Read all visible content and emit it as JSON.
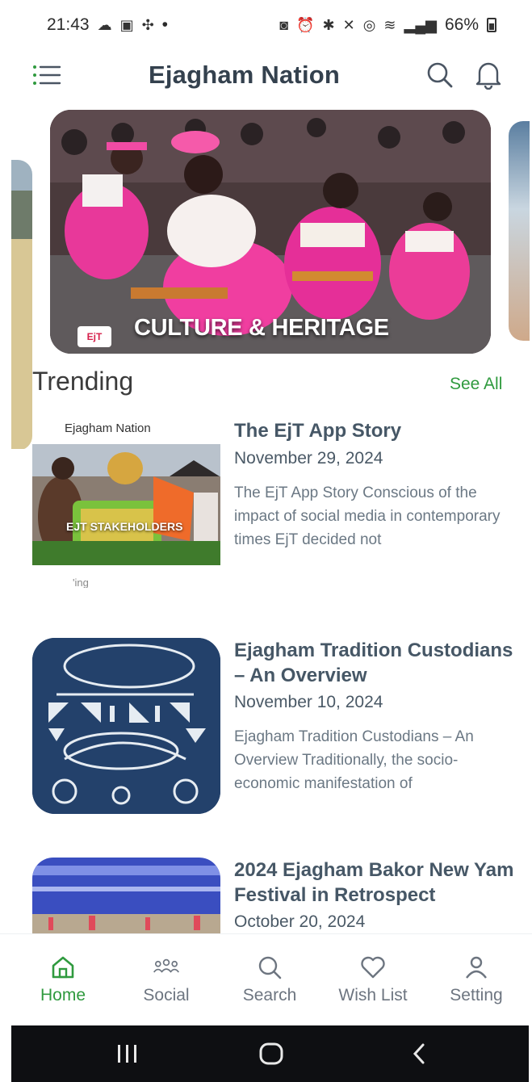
{
  "status_bar": {
    "time": "21:43",
    "dot": "•",
    "battery": "66%"
  },
  "header": {
    "title": "Ejagham Nation",
    "menu_icon": "list-menu-icon",
    "search_icon": "search-icon",
    "bell_icon": "bell-icon"
  },
  "banner": {
    "caption": "CULTURE & HERITAGE",
    "logo_text": "EjT"
  },
  "trending": {
    "title": "Trending",
    "see_all": "See All"
  },
  "articles": [
    {
      "title": "The EjT App Story",
      "date": "November 29, 2024",
      "excerpt": "The EjT App Story Conscious of the impact of social media in contemporary times EjT decided not",
      "thumb_label": "Ejagham Nation",
      "thumb_caption": "EJT STAKEHOLDERS",
      "thumb_under": "'ing"
    },
    {
      "title": "Ejagham Tradition Custodians – An Overview",
      "date": "November 10, 2024",
      "excerpt": "Ejagham Tradition Custodians – An Overview Traditionally, the socio-economic manifestation of"
    },
    {
      "title": "2024 Ejagham Bakor New Yam Festival in Retrospect",
      "date": "October 20, 2024"
    }
  ],
  "bottom_nav": [
    {
      "label": "Home",
      "icon": "home-icon",
      "active": true
    },
    {
      "label": "Social",
      "icon": "people-icon",
      "active": false
    },
    {
      "label": "Search",
      "icon": "search-icon",
      "active": false
    },
    {
      "label": "Wish List",
      "icon": "heart-icon",
      "active": false
    },
    {
      "label": "Setting",
      "icon": "person-icon",
      "active": false
    }
  ],
  "colors": {
    "accent": "#2f9a3e",
    "title": "#34414e",
    "nav_inactive": "#6d7580"
  }
}
